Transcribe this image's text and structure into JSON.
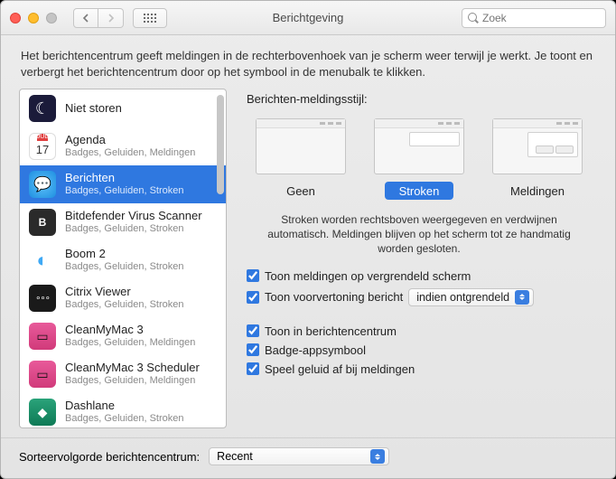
{
  "window": {
    "title": "Berichtgeving"
  },
  "search": {
    "placeholder": "Zoek"
  },
  "description": "Het berichtencentrum geeft meldingen in de rechterbovenhoek van je scherm weer terwijl je werkt. Je toont en verbergt het berichtencentrum door op het symbool in de menubalk te klikken.",
  "apps": [
    {
      "name": "Niet storen",
      "sub": ""
    },
    {
      "name": "Agenda",
      "sub": "Badges, Geluiden, Meldingen",
      "cal_day": "17",
      "cal_mon": "JUL"
    },
    {
      "name": "Berichten",
      "sub": "Badges, Geluiden, Stroken"
    },
    {
      "name": "Bitdefender Virus Scanner",
      "sub": "Badges, Geluiden, Stroken"
    },
    {
      "name": "Boom 2",
      "sub": "Badges, Geluiden, Stroken"
    },
    {
      "name": "Citrix Viewer",
      "sub": "Badges, Geluiden, Stroken"
    },
    {
      "name": "CleanMyMac 3",
      "sub": "Badges, Geluiden, Meldingen"
    },
    {
      "name": "CleanMyMac 3 Scheduler",
      "sub": "Badges, Geluiden, Meldingen"
    },
    {
      "name": "Dashlane",
      "sub": "Badges, Geluiden, Stroken"
    }
  ],
  "detail": {
    "style_label": "Berichten-meldingsstijl:",
    "styles": {
      "none": "Geen",
      "banners": "Stroken",
      "alerts": "Meldingen"
    },
    "help": "Stroken worden rechtsboven weergegeven en verdwijnen automatisch. Meldingen blijven op het scherm tot ze handmatig worden gesloten.",
    "opt_lock": "Toon meldingen op vergrendeld scherm",
    "opt_preview_label": "Toon voorvertoning bericht",
    "opt_preview_value": "indien ontgrendeld",
    "opt_nc": "Toon in berichtencentrum",
    "opt_badge": "Badge-appsymbool",
    "opt_sound": "Speel geluid af bij meldingen"
  },
  "sort": {
    "label": "Sorteervolgorde berichtencentrum:",
    "value": "Recent"
  }
}
